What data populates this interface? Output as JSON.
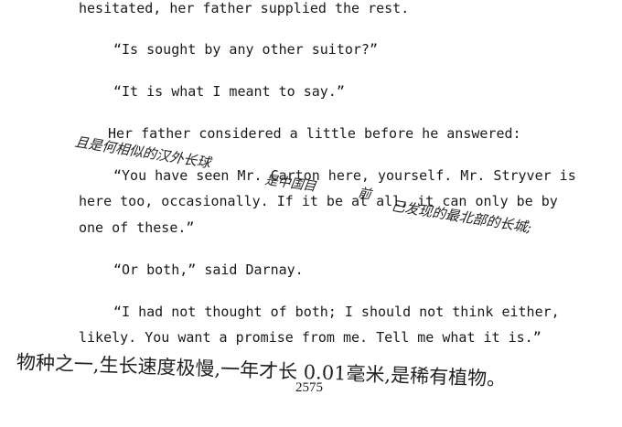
{
  "text_lines": [
    "hesitated, her father supplied the rest.",
    "“Is sought by any other suitor?”",
    "“It is what I meant to say.”",
    "Her father considered a little before he answered:",
    "“You have seen Mr. Carton here, yourself. Mr. Stryver is",
    "here too, occasionally. If it be at all, it can only be by",
    "one of these.”",
    "“Or both,” said Darnay.",
    "“I had not thought of both; I should not think either,",
    "likely. You want a promise from me. Tell me what it is.”"
  ],
  "handwriting": {
    "note_1a": "且是何相似的汉外长球",
    "note_1b": "是中国目",
    "note_1c": "前",
    "note_1d": "已发现的最北部的长城;",
    "note_2": "物种之一,生长速度极慢,一年才长 0.01毫米,是稀有植物。"
  },
  "page_number": "2575"
}
